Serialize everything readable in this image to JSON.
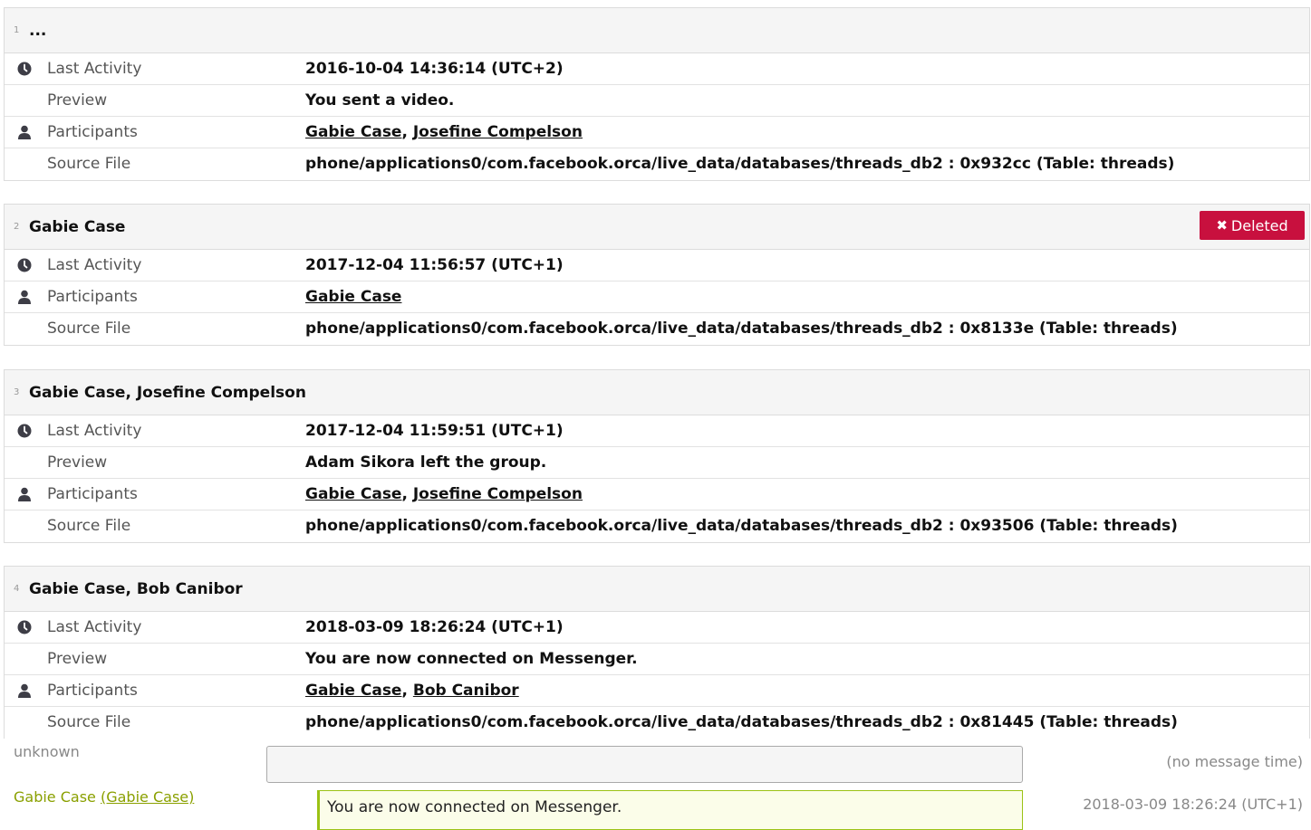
{
  "threads": [
    {
      "num": "1",
      "title": "...",
      "rows": [
        {
          "icon": "clock-icon",
          "label": "Last Activity",
          "value": "2016-10-04 14:36:14 (UTC+2)"
        },
        {
          "icon": "",
          "label": "Preview",
          "value": "You sent a video."
        },
        {
          "icon": "person-icon",
          "label": "Participants",
          "links": [
            "Gabie Case",
            "Josefine Compelson"
          ]
        },
        {
          "icon": "",
          "label": "Source File",
          "value": "phone/applications0/com.facebook.orca/live_data/databases/threads_db2 : 0x932cc (Table: threads)"
        }
      ]
    },
    {
      "num": "2",
      "title": "Gabie Case",
      "badge": {
        "label": "Deleted",
        "icon": "x-icon"
      },
      "rows": [
        {
          "icon": "clock-icon",
          "label": "Last Activity",
          "value": "2017-12-04 11:56:57 (UTC+1)"
        },
        {
          "icon": "person-icon",
          "label": "Participants",
          "links": [
            "Gabie Case"
          ]
        },
        {
          "icon": "",
          "label": "Source File",
          "value": "phone/applications0/com.facebook.orca/live_data/databases/threads_db2 : 0x8133e (Table: threads)"
        }
      ]
    },
    {
      "num": "3",
      "title": "Gabie Case, Josefine Compelson",
      "rows": [
        {
          "icon": "clock-icon",
          "label": "Last Activity",
          "value": "2017-12-04 11:59:51 (UTC+1)"
        },
        {
          "icon": "",
          "label": "Preview",
          "value": "Adam Sikora left the group."
        },
        {
          "icon": "person-icon",
          "label": "Participants",
          "links": [
            "Gabie Case",
            "Josefine Compelson"
          ]
        },
        {
          "icon": "",
          "label": "Source File",
          "value": "phone/applications0/com.facebook.orca/live_data/databases/threads_db2 : 0x93506 (Table: threads)"
        }
      ]
    },
    {
      "num": "4",
      "title": "Gabie Case, Bob Canibor",
      "rows": [
        {
          "icon": "clock-icon",
          "label": "Last Activity",
          "value": "2018-03-09 18:26:24 (UTC+1)"
        },
        {
          "icon": "",
          "label": "Preview",
          "value": "You are now connected on Messenger."
        },
        {
          "icon": "person-icon",
          "label": "Participants",
          "links": [
            "Gabie Case",
            "Bob Canibor"
          ]
        },
        {
          "icon": "",
          "label": "Source File",
          "value": "phone/applications0/com.facebook.orca/live_data/databases/threads_db2 : 0x81445 (Table: threads)"
        }
      ]
    }
  ],
  "messages": [
    {
      "sender": "unknown",
      "text": "",
      "time": "(no message time)"
    },
    {
      "sender": "Gabie Case",
      "sender_link": "(Gabie Case)",
      "text": "You are now connected on Messenger.",
      "time": "2018-03-09 18:26:24 (UTC+1)"
    }
  ]
}
